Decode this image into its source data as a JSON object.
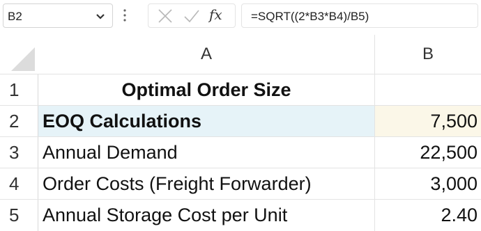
{
  "formula_bar": {
    "name_box": "B2",
    "fx_label": "fx",
    "formula": "=SQRT((2*B3*B4)/B5)"
  },
  "columns": [
    "A",
    "B"
  ],
  "rows": [
    {
      "num": "1",
      "a": "Optimal Order Size",
      "b": ""
    },
    {
      "num": "2",
      "a": "EOQ Calculations",
      "b": "7,500"
    },
    {
      "num": "3",
      "a": "Annual Demand",
      "b": "22,500"
    },
    {
      "num": "4",
      "a": "Order Costs (Freight Forwarder)",
      "b": "3,000"
    },
    {
      "num": "5",
      "a": "Annual Storage Cost per Unit",
      "b": "2.40"
    }
  ],
  "selected_cell": "B2",
  "colors": {
    "selection_a": "#e6f3f8",
    "selection_b": "#fbf7e8"
  }
}
